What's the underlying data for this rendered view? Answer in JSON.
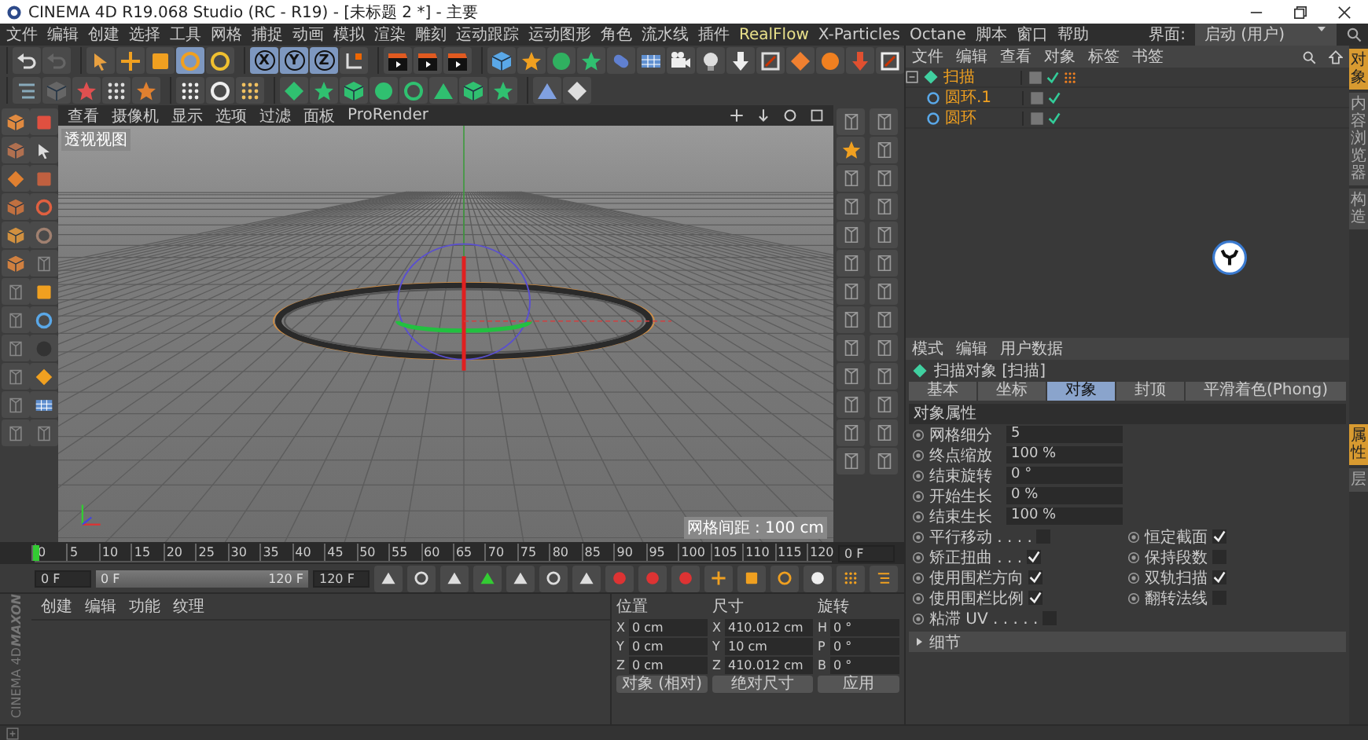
{
  "window": {
    "title": "CINEMA 4D R19.068 Studio (RC - R19) - [未标题 2 *] - 主要"
  },
  "menu": [
    "文件",
    "编辑",
    "创建",
    "选择",
    "工具",
    "网格",
    "捕捉",
    "动画",
    "模拟",
    "渲染",
    "雕刻",
    "运动跟踪",
    "运动图形",
    "角色",
    "流水线",
    "插件",
    "RealFlow",
    "X-Particles",
    "Octane",
    "脚本",
    "窗口",
    "帮助"
  ],
  "layout_selector": {
    "label": "界面:",
    "value": "启动 (用户)"
  },
  "toolbar": {
    "axis_buttons": [
      {
        "label": "X",
        "selected": true
      },
      {
        "label": "Y",
        "selected": true
      },
      {
        "label": "Z",
        "selected": true
      }
    ]
  },
  "viewport": {
    "menu": [
      "查看",
      "摄像机",
      "显示",
      "选项",
      "过滤",
      "面板",
      "ProRender"
    ],
    "view_label": "透视视图",
    "grid_label": "网格间距 : 100 cm"
  },
  "object_manager": {
    "menu": [
      "文件",
      "编辑",
      "查看",
      "对象",
      "标签",
      "书签"
    ],
    "objects": [
      {
        "name": "扫描",
        "selected": true,
        "expanded": true,
        "children": [
          {
            "name": "圆环.1",
            "selected": true
          },
          {
            "name": "圆环",
            "selected": true
          }
        ]
      }
    ]
  },
  "attributes": {
    "menu": [
      "模式",
      "编辑",
      "用户数据"
    ],
    "title": "扫描对象 [扫描]",
    "tabs": [
      {
        "label": "基本",
        "selected": false
      },
      {
        "label": "坐标",
        "selected": false
      },
      {
        "label": "对象",
        "selected": true
      },
      {
        "label": "封顶",
        "selected": false
      },
      {
        "label": "平滑着色(Phong)",
        "selected": false
      }
    ],
    "section": "对象属性",
    "fields": [
      {
        "label": "网格细分",
        "value": "5"
      },
      {
        "label": "终点缩放",
        "value": "100 %"
      },
      {
        "label": "结束旋转",
        "value": "0 °"
      },
      {
        "label": "开始生长",
        "value": "0 %"
      },
      {
        "label": "结束生长",
        "value": "100 %"
      }
    ],
    "checkboxes": [
      {
        "label": "平行移动 . . . .",
        "checked": false
      },
      {
        "label": "恒定截面",
        "checked": true
      },
      {
        "label": "矫正扭曲 . . .",
        "checked": true
      },
      {
        "label": "保持段数",
        "checked": false
      },
      {
        "label": "使用围栏方向",
        "checked": true
      },
      {
        "label": "双轨扫描",
        "checked": true
      },
      {
        "label": "使用围栏比例",
        "checked": true
      },
      {
        "label": "翻转法线",
        "checked": false
      },
      {
        "label": "粘滞 UV . . . . .",
        "checked": false
      }
    ],
    "collapsed_section": {
      "label": "细节",
      "expanded": false
    }
  },
  "right_tabs": {
    "top": [
      {
        "label": "对象",
        "selected": true
      },
      {
        "label": "内容浏览器",
        "selected": false
      },
      {
        "label": "构造",
        "selected": false
      }
    ],
    "bottom": [
      {
        "label": "属性",
        "selected": true
      },
      {
        "label": "层",
        "selected": false
      }
    ]
  },
  "timeline": {
    "ticks": [
      "0",
      "5",
      "10",
      "15",
      "20",
      "25",
      "30",
      "35",
      "40",
      "45",
      "50",
      "55",
      "60",
      "65",
      "70",
      "75",
      "80",
      "85",
      "90",
      "95",
      "100",
      "105",
      "110",
      "115",
      "120"
    ],
    "frame_field": "0 F",
    "start_field": "0 F",
    "range": {
      "start": "0 F",
      "end": "120 F",
      "level": 1
    },
    "end_field": "120 F"
  },
  "material_manager": {
    "menu": [
      "创建",
      "编辑",
      "功能",
      "纹理"
    ]
  },
  "coordinates": {
    "headers": [
      "位置",
      "尺寸",
      "旋转"
    ],
    "rows": [
      {
        "axis": "X",
        "position": "0 cm",
        "size_axis": "X",
        "size": "410.012 cm",
        "rotation_axis": "H",
        "rotation": "0 °"
      },
      {
        "axis": "Y",
        "position": "0 cm",
        "size_axis": "Y",
        "size": "10 cm",
        "rotation_axis": "P",
        "rotation": "0 °"
      },
      {
        "axis": "Z",
        "position": "0 cm",
        "size_axis": "Z",
        "size": "410.012 cm",
        "rotation_axis": "B",
        "rotation": "0 °"
      }
    ],
    "mode": "对象 (相对)",
    "size_mode": "绝对尺寸",
    "apply": "应用"
  },
  "branding": {
    "maker": "MAXON",
    "product": "CINEMA 4D"
  }
}
